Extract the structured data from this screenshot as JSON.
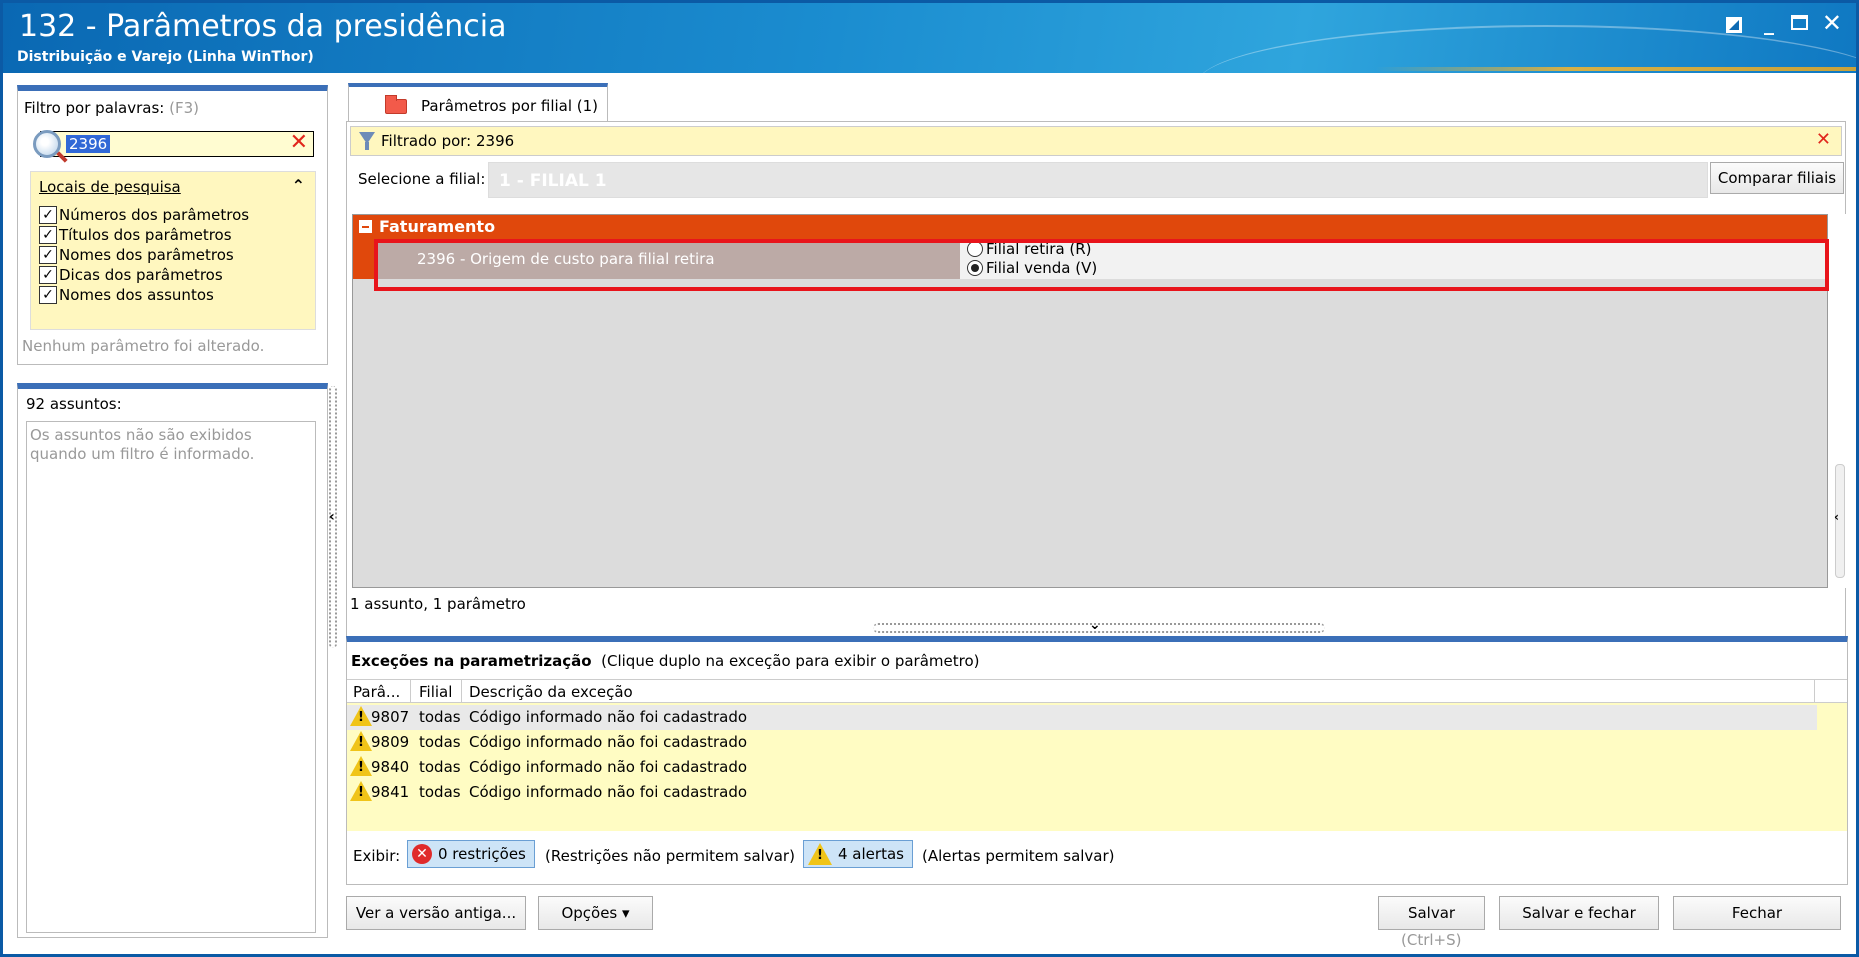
{
  "window": {
    "title": "132 - Parâmetros da presidência",
    "subtitle": "Distribuição e Varejo (Linha WinThor)",
    "controls": {
      "restore": "restore-icon",
      "minimize": "_",
      "maximize": "maximize-icon",
      "close": "✕"
    }
  },
  "filter": {
    "label": "Filtro por palavras:",
    "shortcut": "(F3)",
    "value": "2396",
    "clear": "✕"
  },
  "locais": {
    "title": "Locais de pesquisa",
    "collapse": "⌃",
    "items": [
      {
        "label": "Números dos parâmetros",
        "checked": true
      },
      {
        "label": "Títulos dos parâmetros",
        "checked": true
      },
      {
        "label": "Nomes dos parâmetros",
        "checked": true
      },
      {
        "label": "Dicas dos parâmetros",
        "checked": true
      },
      {
        "label": "Nomes dos assuntos",
        "checked": true
      }
    ],
    "status": "Nenhum parâmetro foi alterado."
  },
  "assuntos": {
    "count": "92 assuntos:",
    "message": "Os assuntos não são exibidos quando um filtro é informado."
  },
  "tab": {
    "label": "Parâmetros por filial  (1)"
  },
  "filtered": {
    "text": "Filtrado por: 2396",
    "clear": "✕"
  },
  "filial": {
    "label": "Selecione a filial:",
    "value": "1 - FILIAL 1",
    "compare_button": "Comparar filiais"
  },
  "group": {
    "name": "Faturamento",
    "param": {
      "name": "2396 - Origem de custo para filial retira",
      "options": [
        {
          "label": "Filial retira (R)",
          "selected": false
        },
        {
          "label": "Filial venda (V)",
          "selected": true
        }
      ]
    }
  },
  "result_count": "1 assunto, 1 parâmetro",
  "exceptions": {
    "title": "Exceções na parametrização",
    "hint": "(Clique duplo na exceção para exibir o parâmetro)",
    "columns": [
      "Parâ...",
      "Filial",
      "Descrição da exceção"
    ],
    "rows": [
      {
        "param": "9807",
        "filial": "todas",
        "desc": "Código informado não foi cadastrado"
      },
      {
        "param": "9809",
        "filial": "todas",
        "desc": "Código informado não foi cadastrado"
      },
      {
        "param": "9840",
        "filial": "todas",
        "desc": "Código informado não foi cadastrado"
      },
      {
        "param": "9841",
        "filial": "todas",
        "desc": "Código informado não foi cadastrado"
      }
    ],
    "show_label": "Exibir:",
    "restrictions_chip": "0 restrições",
    "restrictions_note": "(Restrições não permitem salvar)",
    "alerts_chip": "4 alertas",
    "alerts_note": "(Alertas permitem salvar)"
  },
  "buttons": {
    "old_version": "Ver a versão antiga...",
    "options": "Opções ▾",
    "save": "Salvar",
    "save_shortcut": "(Ctrl+S)",
    "save_close": "Salvar e fechar",
    "close": "Fechar"
  },
  "colors": {
    "accent": "#3b6fb8",
    "group_header": "#e0480c",
    "highlight_box": "#e8141b",
    "yellow_bg": "#fff7bf"
  }
}
